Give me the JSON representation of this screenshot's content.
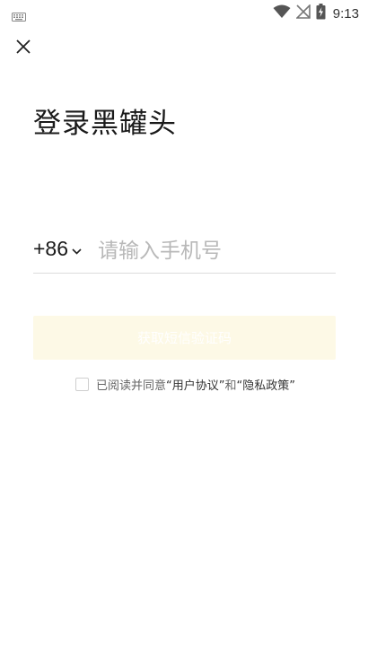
{
  "status_bar": {
    "time": "9:13",
    "icons": [
      "keyboard-icon",
      "wifi-icon",
      "no-signal-icon",
      "battery-charging-icon"
    ]
  },
  "header": {
    "close_icon": "close-icon"
  },
  "title": "登录黑罐头",
  "phone": {
    "country_code": "+86",
    "placeholder": "请输入手机号",
    "value": ""
  },
  "code_button": {
    "label": "获取短信验证码"
  },
  "agreement": {
    "prefix": "已阅读并同意",
    "user_agreement": "“用户协议”",
    "conjunction": "和",
    "privacy_policy": "“隐私政策”"
  },
  "colors": {
    "button_bg": "#fdf9e6",
    "title": "#1a1a1a",
    "placeholder": "#b8b8b8"
  }
}
